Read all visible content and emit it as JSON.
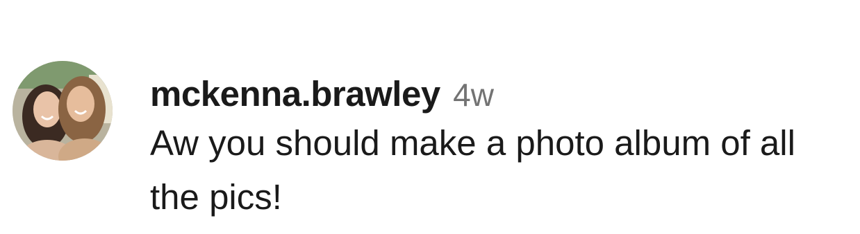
{
  "comment": {
    "avatar_icon": "user-photo-avatar",
    "username": "mckenna.brawley",
    "timestamp": "4w",
    "text": "Aw you should make a photo album of all the pics!"
  },
  "colors": {
    "username": "#1a1a1a",
    "timestamp": "#737373",
    "background": "#ffffff"
  }
}
